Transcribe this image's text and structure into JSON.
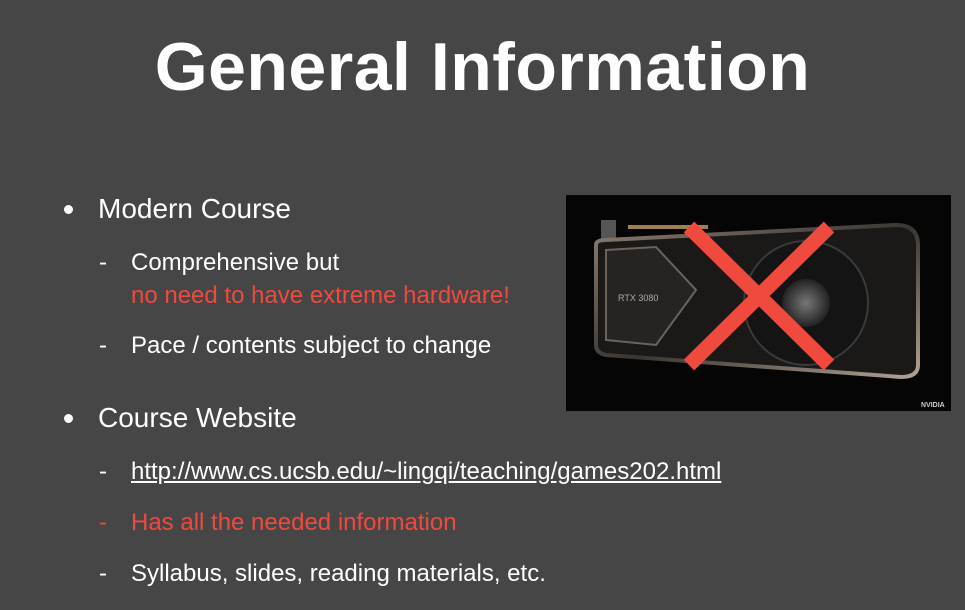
{
  "title": "General Information",
  "bullets": [
    {
      "label": "Modern Course",
      "items": [
        {
          "line1": "Comprehensive but",
          "line2": "no need to have extreme hardware!"
        },
        {
          "line1": "Pace / contents subject to change"
        }
      ]
    },
    {
      "label": "Course Website",
      "items": [
        {
          "line1": "http://www.cs.ucsb.edu/~lingqi/teaching/games202.html"
        },
        {
          "line1": "Has all the needed information"
        },
        {
          "line1": "Syllabus, slides, reading materials, etc."
        }
      ]
    }
  ],
  "image": {
    "card_label": "RTX 3080",
    "brand": "NVIDIA"
  },
  "colors": {
    "background": "#464646",
    "accent": "#f0493e"
  }
}
